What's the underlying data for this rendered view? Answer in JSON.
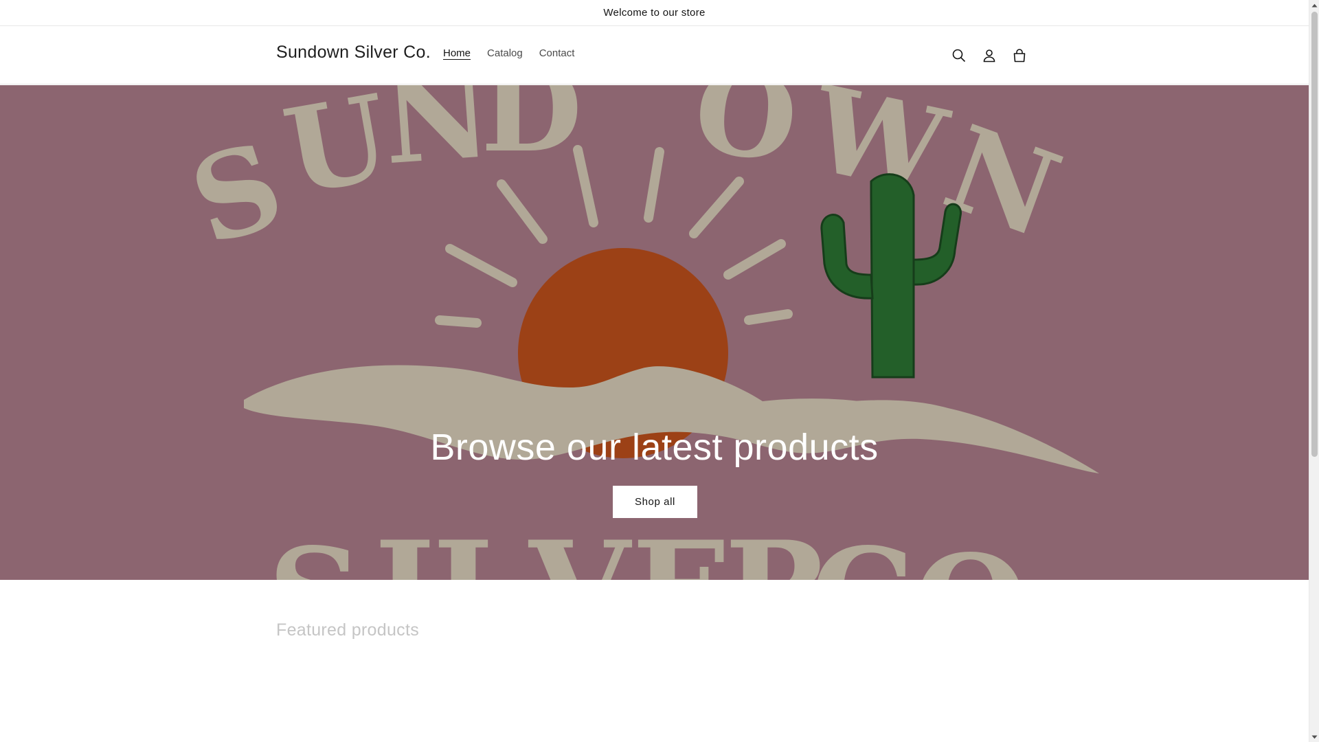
{
  "announcement": {
    "text": "Welcome to our store"
  },
  "header": {
    "logo": "Sundown Silver Co.",
    "nav": [
      {
        "label": "Home",
        "active": true
      },
      {
        "label": "Catalog",
        "active": false
      },
      {
        "label": "Contact",
        "active": false
      }
    ],
    "icons": [
      "search-icon",
      "account-icon",
      "cart-icon"
    ]
  },
  "hero": {
    "heading": "Browse our latest products",
    "button_label": "Shop all",
    "background_art_text_top": "SUNDOWN",
    "background_art_text_bottom": "SILVER CO",
    "colors": {
      "background": "#b48290",
      "sun": "#c8541d",
      "cactus": "#2e7a35",
      "cream": "#e3d8c2"
    }
  },
  "featured": {
    "title": "Featured products"
  }
}
